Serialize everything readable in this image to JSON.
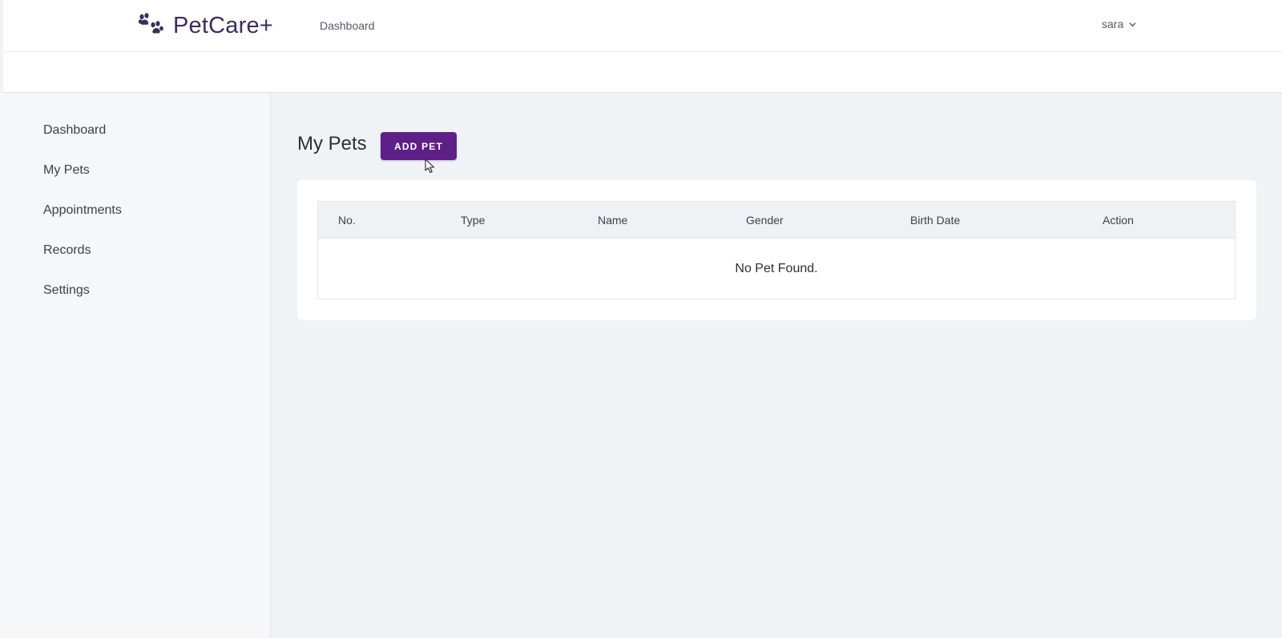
{
  "brand": {
    "name": "PetCare+",
    "icon": "paw-icon",
    "color": "#3a2e5c"
  },
  "top_nav": {
    "dashboard_label": "Dashboard"
  },
  "user": {
    "name": "sara",
    "icon": "chevron-down-icon"
  },
  "sidebar": {
    "items": [
      {
        "label": "Dashboard"
      },
      {
        "label": "My Pets"
      },
      {
        "label": "Appointments"
      },
      {
        "label": "Records"
      },
      {
        "label": "Settings"
      }
    ]
  },
  "main": {
    "title": "My Pets",
    "add_button_label": "ADD PET",
    "accent_color": "#5e1f86",
    "table": {
      "columns": [
        "No.",
        "Type",
        "Name",
        "Gender",
        "Birth Date",
        "Action"
      ],
      "empty_message": "No Pet Found."
    }
  }
}
